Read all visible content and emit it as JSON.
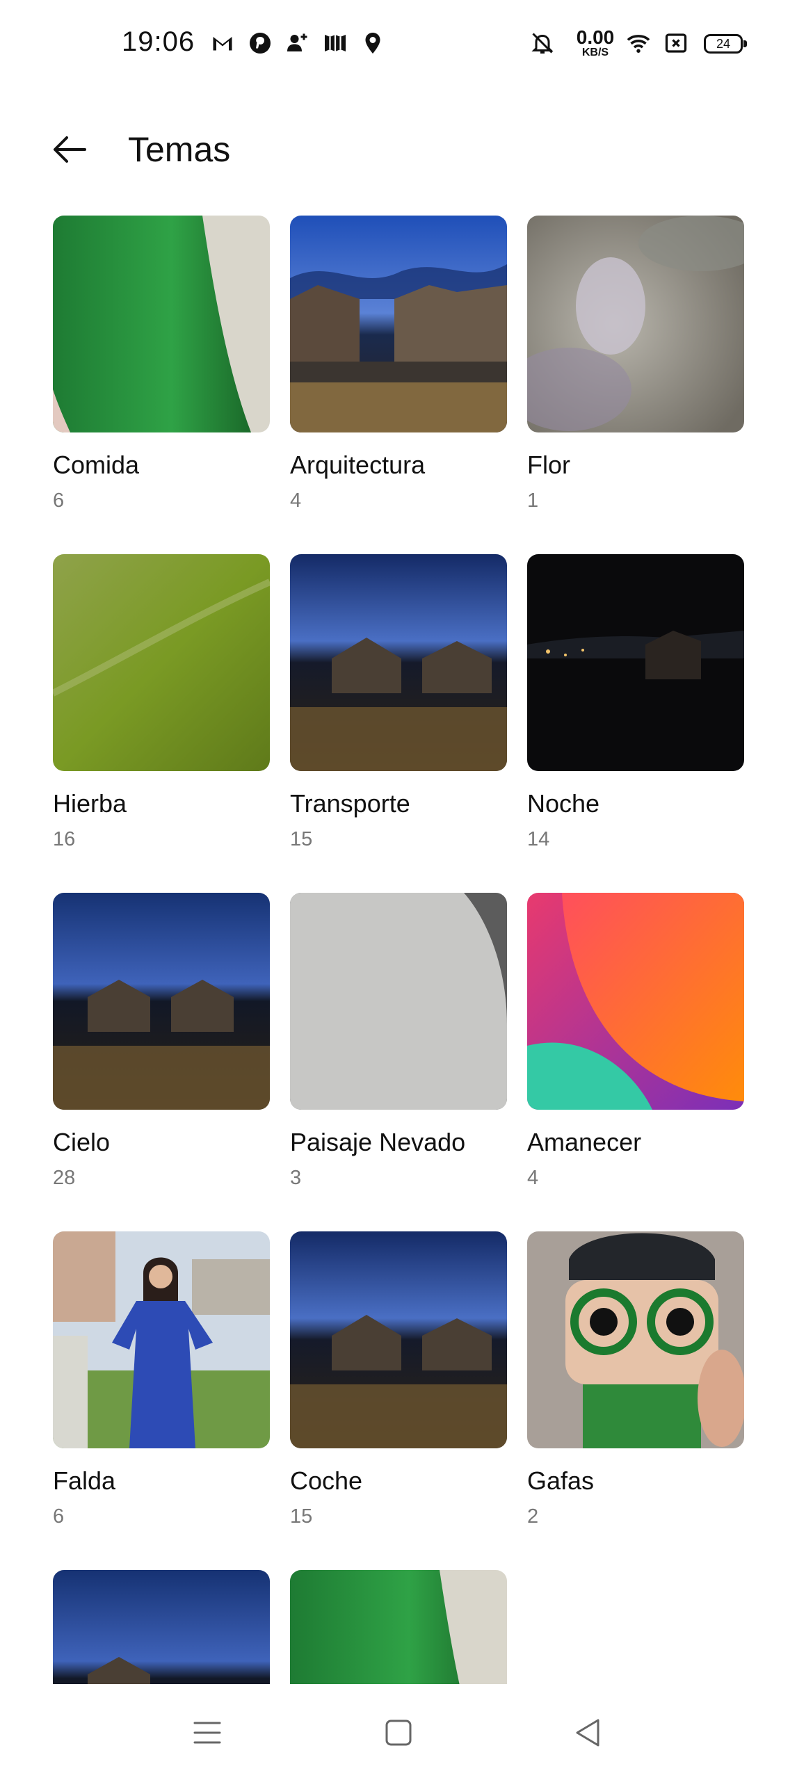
{
  "status_bar": {
    "time": "19:06",
    "net_speed_value": "0.00",
    "net_speed_unit": "KB/S",
    "battery_level": "24",
    "icons": [
      "gmail-icon",
      "pinterest-icon",
      "add-contact-icon",
      "maps-m-icon",
      "location-pin-icon",
      "mute-icon",
      "wifi-icon",
      "close-box-icon",
      "battery-icon"
    ]
  },
  "header": {
    "title": "Temas",
    "back_icon": "arrow-left-icon"
  },
  "topics": [
    {
      "name": "Comida",
      "count": "6"
    },
    {
      "name": "Arquitectura",
      "count": "4"
    },
    {
      "name": "Flor",
      "count": "1"
    },
    {
      "name": "Hierba",
      "count": "16"
    },
    {
      "name": "Transporte",
      "count": "15"
    },
    {
      "name": "Noche",
      "count": "14"
    },
    {
      "name": "Cielo",
      "count": "28"
    },
    {
      "name": "Paisaje Nevado",
      "count": "3"
    },
    {
      "name": "Amanecer",
      "count": "4"
    },
    {
      "name": "Falda",
      "count": "6"
    },
    {
      "name": "Coche",
      "count": "15"
    },
    {
      "name": "Gafas",
      "count": "2"
    }
  ],
  "partial_thumbnails": [
    "night-sky-thumbnail",
    "green-macro-thumbnail"
  ],
  "navbar": {
    "icons": [
      "menu-icon",
      "home-square-icon",
      "back-triangle-icon"
    ]
  },
  "colors": {
    "accent_text": "#111111",
    "secondary_text": "#777777",
    "background": "#ffffff"
  }
}
